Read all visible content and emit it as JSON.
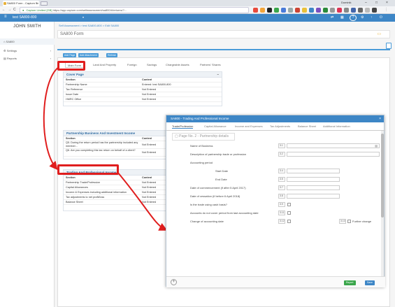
{
  "browser": {
    "tab_title": "SA800 Form - Capium Sr",
    "tab_close": "×",
    "user_name": "Dominik",
    "url_secure": "Capium Limited [GB]",
    "url_rest": "https://app.capium.com/selfassessment/sa800/#/returns/?...",
    "nav_back": "←",
    "nav_forward": "→",
    "nav_reload": "C",
    "win_min": "–",
    "win_max": "□",
    "win_close": "×"
  },
  "app_header": {
    "menu_icon": "≡",
    "title": "test SA800-800",
    "dropdown": "▾"
  },
  "sidebar": {
    "user_name": "JOHN SMITH",
    "items": [
      {
        "label": "SA800",
        "icon": "home-icon",
        "glyph": "⌂"
      },
      {
        "label": "Settings",
        "icon": "gear-icon",
        "glyph": "⚙"
      },
      {
        "label": "Reports",
        "icon": "report-icon",
        "glyph": "▤"
      }
    ],
    "chevron": "›"
  },
  "main": {
    "breadcrumb": "Self Assessment > test SA800-800 > Edit SA800",
    "page_title": "SA800 Form",
    "toolbar": {
      "btn1": "Add Page",
      "btn2": "Add Attachment",
      "btn3": "Refresh"
    },
    "form_tabs": [
      "Main Form",
      "Land And Property",
      "Foreign",
      "Savings",
      "Chargeable Assets",
      "Partners' Shares"
    ],
    "collapse": "–",
    "cover_page": {
      "title": "Cover Page",
      "col1": "Section",
      "col2": "Content",
      "rows": [
        [
          "Partnership Name",
          "Entered: test SA800-800"
        ],
        [
          "Tax Reference",
          "Not Entered"
        ],
        [
          "Issue Date",
          "Not Entered"
        ],
        [
          "HMRC Office",
          "Not Entered"
        ],
        [
          "Issue Address",
          "Not Entered"
        ]
      ]
    },
    "partnership": {
      "title": "Partnership Business And Investment Income",
      "col1": "Section",
      "col2": "Content",
      "rows": [
        [
          "Q5. During the return period has the partnership included any member...",
          "Not Entered"
        ],
        [
          "Q6. Are you completing this tax return on behalf of a client?",
          "Not Entered"
        ]
      ]
    },
    "trading": {
      "title": "Trading And Professional Income",
      "col1": "Section",
      "col2": "Content",
      "rows": [
        [
          "Partnership Trade/Profession",
          "Not Entered"
        ],
        [
          "Capital Allowances",
          "Not Entered"
        ],
        [
          "Income & Expenses including additional information",
          "Not Entered"
        ],
        [
          "Tax adjustments to net profit/loss",
          "Not Entered"
        ],
        [
          "Balance Sheet",
          "Not Entered"
        ]
      ]
    }
  },
  "dialog": {
    "title": "SA800 - Trading And Professional Income",
    "close": "×",
    "tabs": [
      "Trade/Profession",
      "Capital Allowance",
      "Income and Expenses",
      "Tax Adjustments",
      "Balance Sheet",
      "Additional Information"
    ],
    "subtitle": "Page No. 2 - Partnership details",
    "fields": [
      {
        "label": "Name of Business",
        "code": "3.1"
      },
      {
        "label": "Description of partnership trade or profession",
        "code": "3.2"
      },
      {
        "label": "Accounting period",
        "code": ""
      },
      {
        "label": "Start Date",
        "code": "3.4"
      },
      {
        "label": "End Date",
        "code": "3.5"
      },
      {
        "label": "Date of commencement (if after 5 April 2017)",
        "code": "3.7"
      },
      {
        "label": "Date of cessation (if before 6 April 2018)",
        "code": "3.8"
      },
      {
        "label": "Is the trade using cash basis?",
        "code": "3.9"
      },
      {
        "label": "Accounts do not cover period from last accounting date",
        "code": "3.11"
      },
      {
        "label": "Change of accounting date",
        "code": "3.12"
      }
    ],
    "extra_code": "3.13",
    "extra_label": "Further change",
    "add_icon": "+",
    "report_btn": "Report",
    "save_btn": "Save"
  }
}
